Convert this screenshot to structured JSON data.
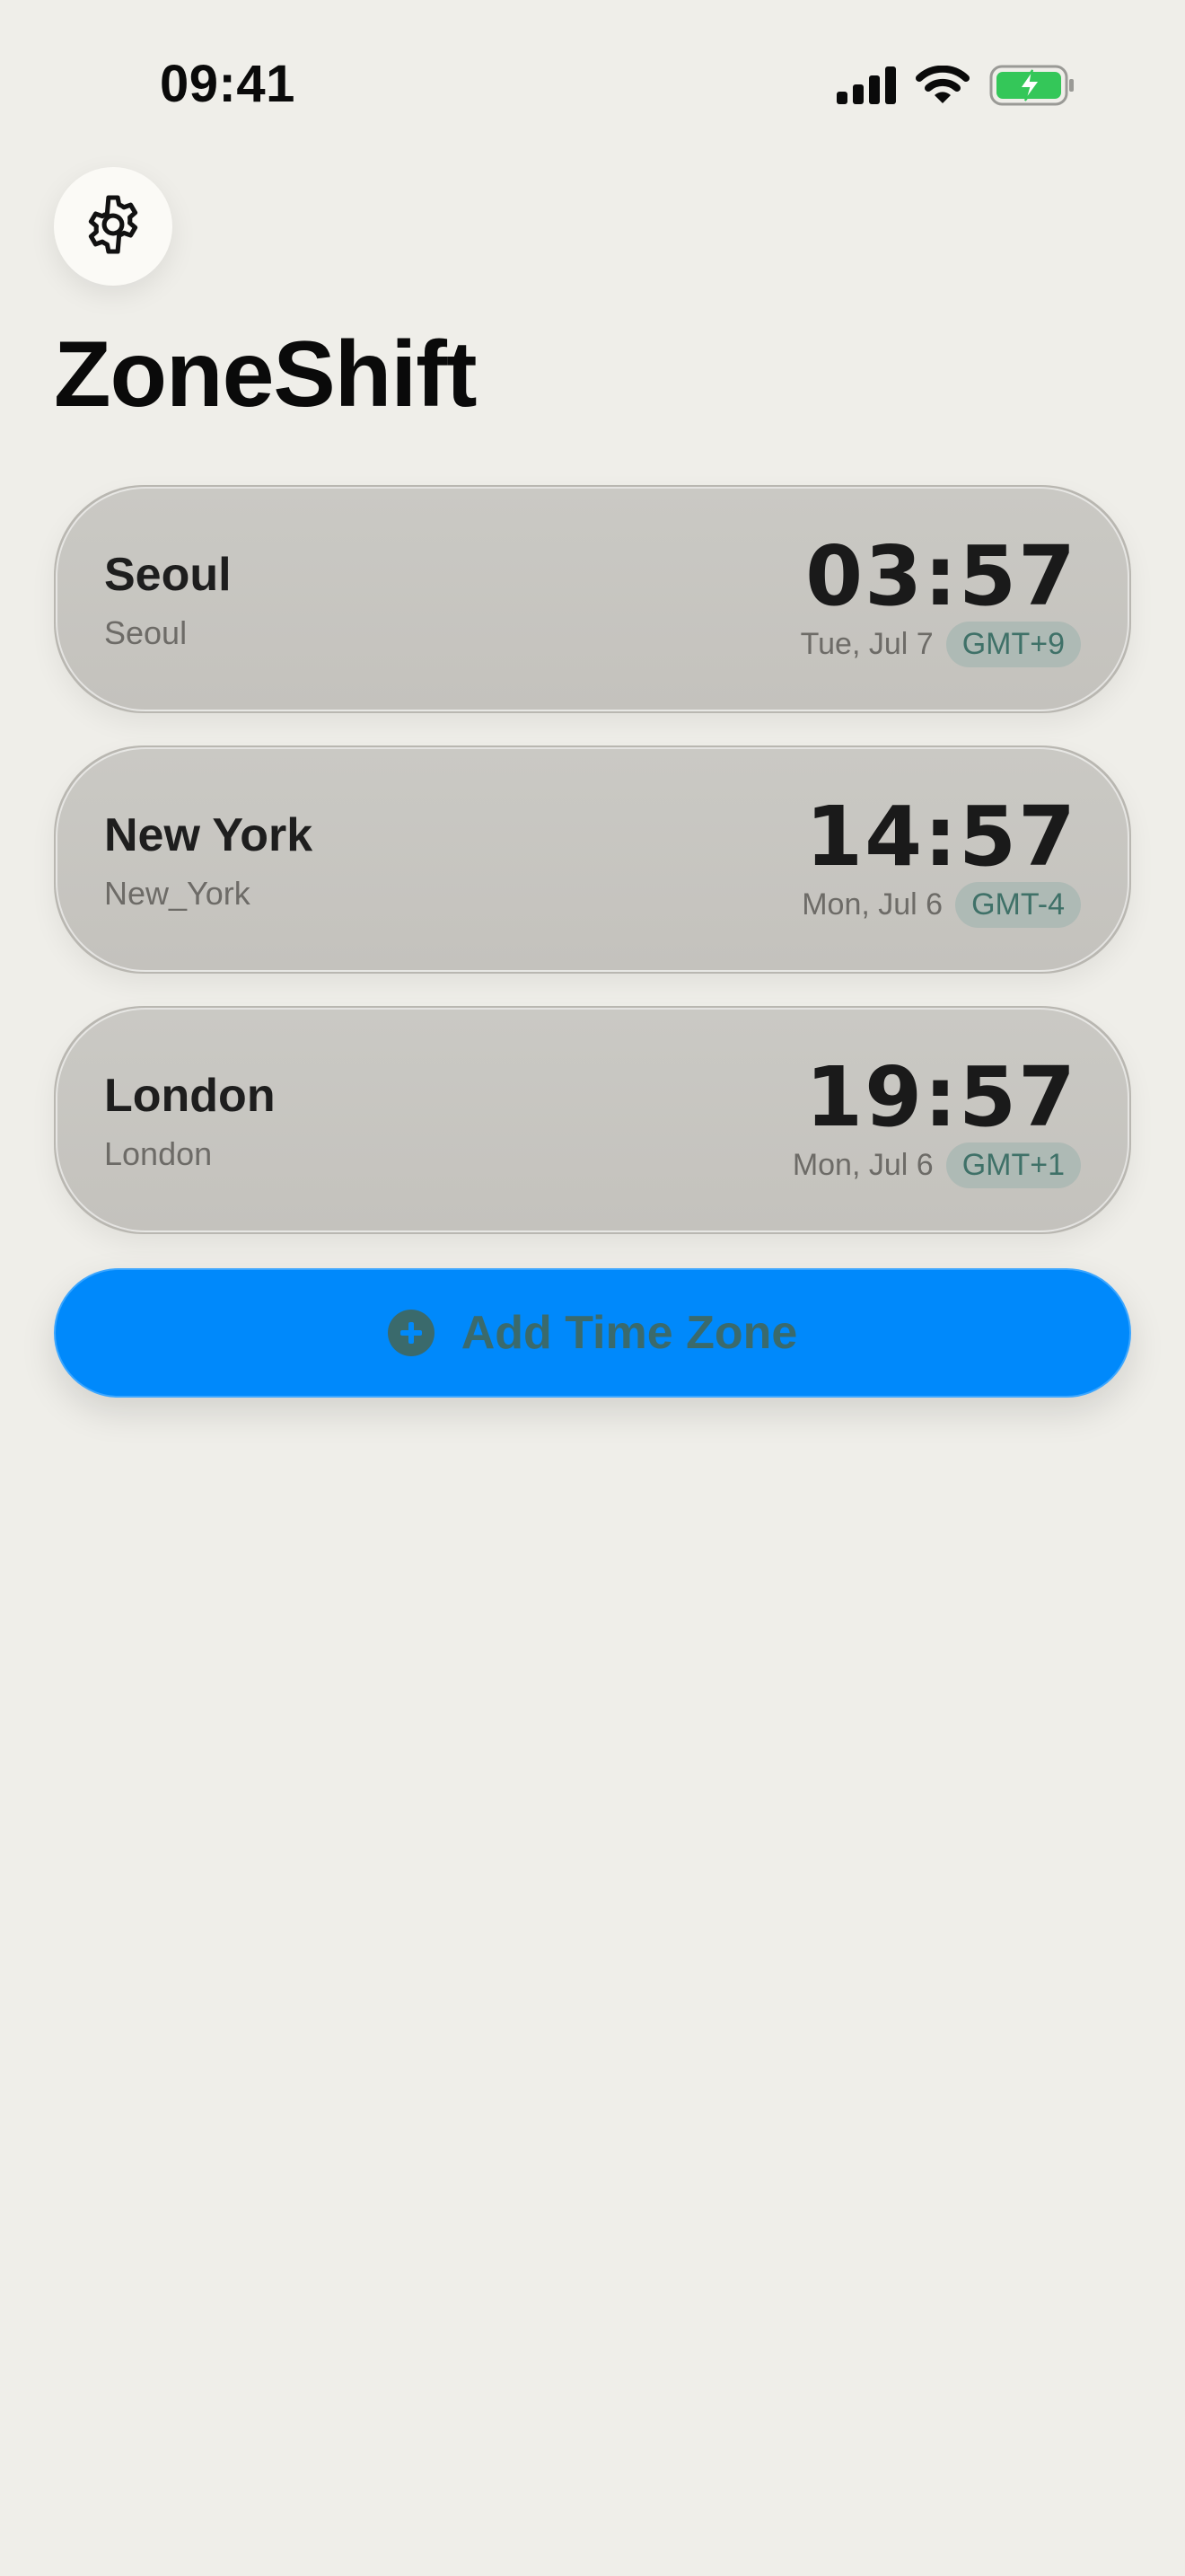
{
  "status_bar": {
    "time": "09:41",
    "icons": [
      "cellular-signal-icon",
      "wifi-icon",
      "battery-charging-icon"
    ]
  },
  "settings": {
    "icon": "gear-icon"
  },
  "app": {
    "title": "ZoneShift"
  },
  "zones": [
    {
      "city": "Seoul",
      "tz_id": "Seoul",
      "time": "03:57",
      "date": "Tue, Jul 7",
      "offset": "GMT+9"
    },
    {
      "city": "New York",
      "tz_id": "New_York",
      "time": "14:57",
      "date": "Mon, Jul 6",
      "offset": "GMT-4"
    },
    {
      "city": "London",
      "tz_id": "London",
      "time": "19:57",
      "date": "Mon, Jul 6",
      "offset": "GMT+1"
    }
  ],
  "add_button": {
    "label": "Add Time Zone",
    "icon": "plus-circle-icon"
  },
  "colors": {
    "background": "#efeee9",
    "accent": "#0089fb",
    "badge_text": "#3f7168",
    "battery_green": "#34c759"
  }
}
